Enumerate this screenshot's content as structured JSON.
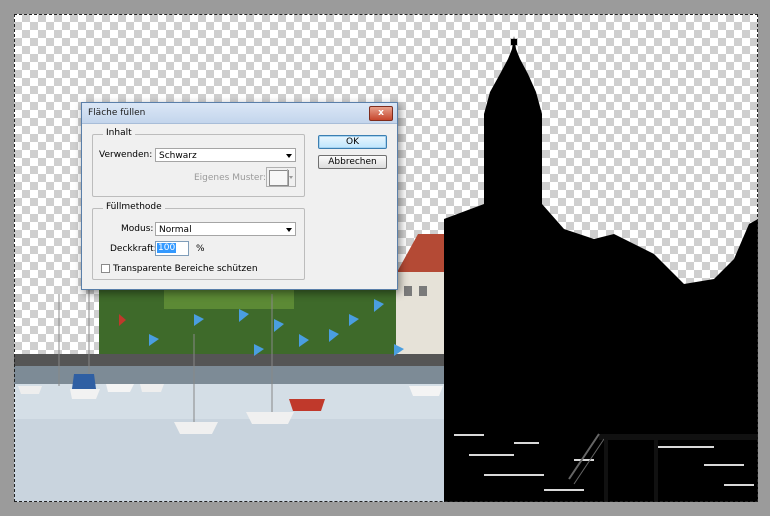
{
  "dialog": {
    "title": "Fläche füllen",
    "close_glyph": "x",
    "content_group": {
      "label": "Inhalt",
      "use_label": "Verwenden:",
      "use_value": "Schwarz",
      "custom_pattern_label": "Eigenes Muster:"
    },
    "blend_group": {
      "label": "Füllmethode",
      "mode_label": "Modus:",
      "mode_value": "Normal",
      "opacity_label": "Deckkraft:",
      "opacity_value": "100",
      "opacity_unit": "%",
      "preserve_transparency_label": "Transparente Bereiche schützen",
      "preserve_transparency_checked": false
    },
    "ok_label": "OK",
    "cancel_label": "Abbrechen"
  },
  "colors": {
    "canvas_bg": "#9b9b9b",
    "silhouette": "#000000",
    "water": "#cfd9e2",
    "flag_blue": "#4a9ee0"
  },
  "icons": {
    "close": "close-icon",
    "dropdown": "chevron-down-icon"
  }
}
